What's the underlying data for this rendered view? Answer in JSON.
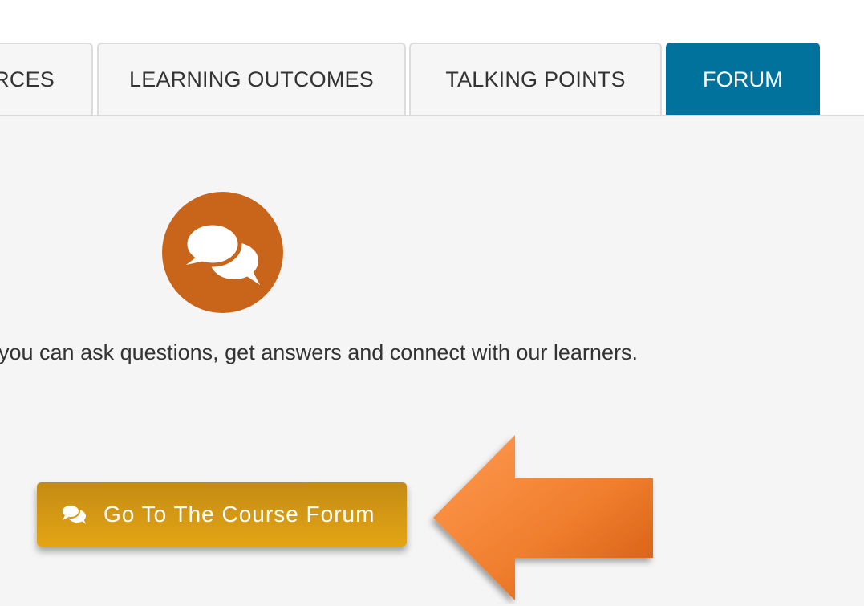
{
  "tabs": [
    {
      "label": "RCES",
      "active": false
    },
    {
      "label": "LEARNING OUTCOMES",
      "active": false
    },
    {
      "label": "TALKING POINTS",
      "active": false
    },
    {
      "label": "FORUM",
      "active": true
    }
  ],
  "forum": {
    "icon": "speech-bubbles-icon",
    "description": "you can ask questions, get answers and connect with our learners.",
    "button_label": "Go To The Course Forum",
    "button_icon": "comments-icon"
  },
  "annotation": {
    "arrow": "left-arrow-icon",
    "arrow_color": "#f07f2e"
  },
  "colors": {
    "active_tab": "#00729b",
    "badge": "#c8651b",
    "button": "#dc9e14",
    "panel": "#f5f5f5"
  }
}
